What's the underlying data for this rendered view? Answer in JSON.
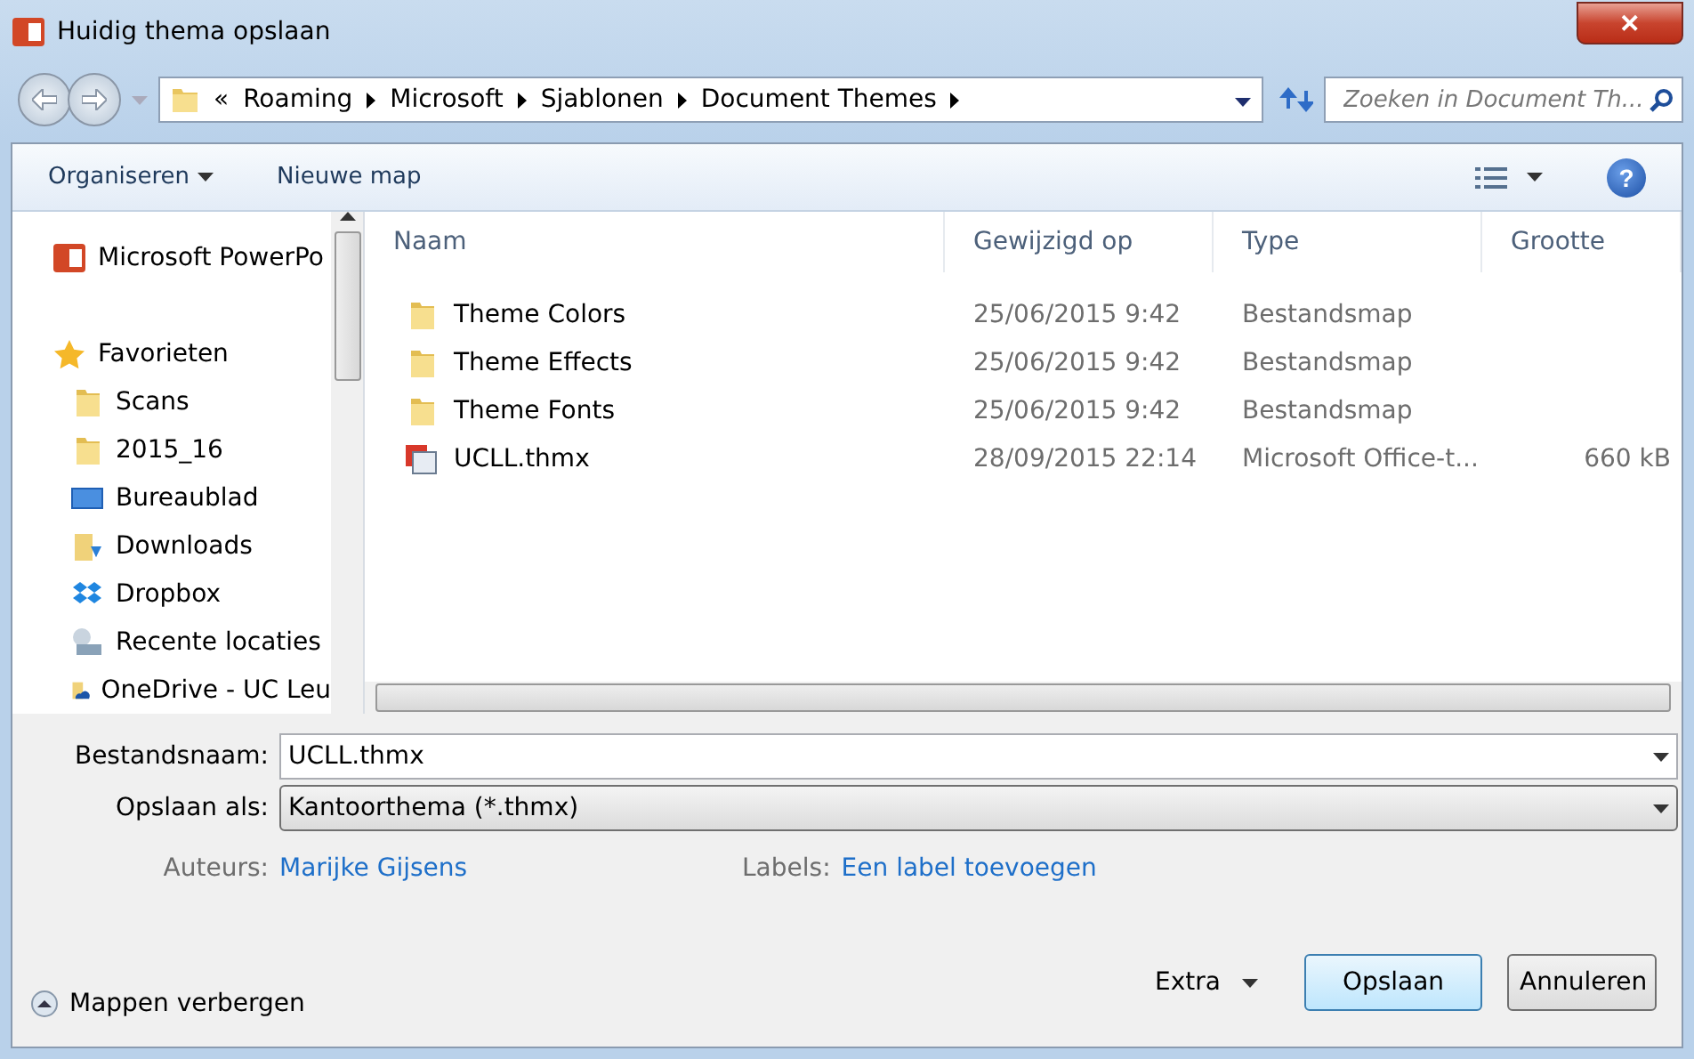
{
  "window": {
    "title": "Huidig thema opslaan",
    "close": "✕"
  },
  "address": {
    "separator": "«",
    "crumbs": [
      "Roaming",
      "Microsoft",
      "Sjablonen",
      "Document Themes"
    ]
  },
  "search": {
    "placeholder": "Zoeken in Document Th..."
  },
  "toolbar": {
    "organize": "Organiseren",
    "new_folder": "Nieuwe map",
    "help": "?"
  },
  "sidebar": {
    "items": [
      {
        "label": "Microsoft PowerPo",
        "kind": "powerpoint"
      },
      {
        "label": "Favorieten",
        "kind": "star"
      },
      {
        "label": "Scans",
        "kind": "folder"
      },
      {
        "label": "2015_16",
        "kind": "folder"
      },
      {
        "label": "Bureaublad",
        "kind": "desktop"
      },
      {
        "label": "Downloads",
        "kind": "downloads"
      },
      {
        "label": "Dropbox",
        "kind": "dropbox"
      },
      {
        "label": "Recente locaties",
        "kind": "recent"
      },
      {
        "label": "OneDrive - UC Leu",
        "kind": "onedrive"
      }
    ]
  },
  "table": {
    "columns": [
      "Naam",
      "Gewijzigd op",
      "Type",
      "Grootte"
    ],
    "rows": [
      {
        "name": "Theme Colors",
        "modified": "25/06/2015 9:42",
        "type": "Bestandsmap",
        "kind": "folder"
      },
      {
        "name": "Theme Effects",
        "modified": "25/06/2015 9:42",
        "type": "Bestandsmap",
        "kind": "folder"
      },
      {
        "name": "Theme Fonts",
        "modified": "25/06/2015 9:42",
        "type": "Bestandsmap",
        "kind": "folder"
      },
      {
        "name": "UCLL.thmx",
        "modified": "28/09/2015 22:14",
        "type": "Microsoft Office-t...",
        "size": "660 kB",
        "kind": "theme"
      }
    ]
  },
  "form": {
    "filename_label": "Bestandsnaam:",
    "filename": "UCLL.thmx",
    "type_label": "Opslaan als:",
    "type": "Kantoorthema (*.thmx)",
    "authors_label": "Auteurs:",
    "authors": "Marijke Gijsens",
    "tags_label": "Labels:",
    "tags": "Een label toevoegen"
  },
  "footer": {
    "hide_folders": "Mappen verbergen",
    "extra": "Extra",
    "save": "Opslaan",
    "cancel": "Annuleren"
  }
}
